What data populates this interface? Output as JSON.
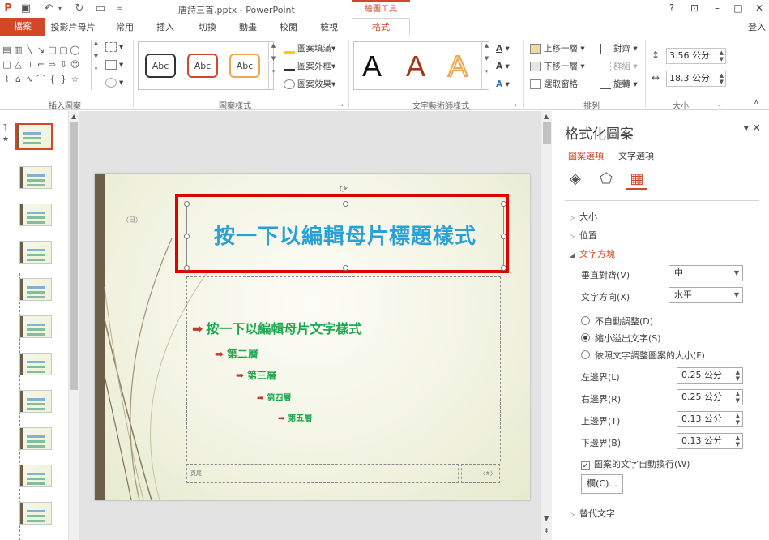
{
  "window": {
    "title": "唐詩三首.pptx - PowerPoint",
    "tools_header": "繪圖工具",
    "help": "?",
    "restore_ribbon": "⊡",
    "minimize": "–",
    "maximize": "□",
    "close": "✕"
  },
  "tabs": [
    {
      "id": "file",
      "label": "檔案"
    },
    {
      "id": "master",
      "label": "投影片母片"
    },
    {
      "id": "home",
      "label": "常用"
    },
    {
      "id": "insert",
      "label": "插入"
    },
    {
      "id": "transitions",
      "label": "切換"
    },
    {
      "id": "animations",
      "label": "動畫"
    },
    {
      "id": "review",
      "label": "校閱"
    },
    {
      "id": "view",
      "label": "檢視"
    },
    {
      "id": "format",
      "label": "格式"
    }
  ],
  "login": "登入",
  "ribbon": {
    "groups": {
      "insert_shapes": "插入圖案",
      "shape_styles": "圖案樣式",
      "wordart_styles": "文字藝術師樣式",
      "arrange": "排列",
      "size": "大小"
    },
    "style_samples": [
      "Abc",
      "Abc",
      "Abc"
    ],
    "shape_fill": "圖案填滿",
    "shape_outline": "圖案外框",
    "shape_effects": "圖案效果",
    "wordart_letters": [
      "A",
      "A",
      "A"
    ],
    "bring_forward": "上移一層",
    "send_backward": "下移一層",
    "selection_pane": "選取窗格",
    "align": "對齊",
    "group": "群組",
    "rotate": "旋轉",
    "height": "3.56 公分",
    "width": "18.3 公分"
  },
  "thumbs": {
    "active_number": "1",
    "active_marker": "★"
  },
  "slide": {
    "date_placeholder": "（日）",
    "title": "按一下以編輯母片標題樣式",
    "bullets": [
      {
        "text": "按一下以編輯母片文字樣式",
        "level": 1
      },
      {
        "text": "第二層",
        "level": 2
      },
      {
        "text": "第三層",
        "level": 3
      },
      {
        "text": "第四層",
        "level": 4
      },
      {
        "text": "第五層",
        "level": 5
      }
    ],
    "footer": "頁尾",
    "slide_number": "〈#〉"
  },
  "pane": {
    "title": "格式化圖案",
    "tab_shape": "圖案選項",
    "tab_text": "文字選項",
    "sections": {
      "size": "大小",
      "position": "位置",
      "textbox": "文字方塊",
      "alt_text": "替代文字"
    },
    "vertical_align_label": "垂直對齊(V)",
    "vertical_align_value": "中",
    "text_direction_label": "文字方向(X)",
    "text_direction_value": "水平",
    "autofit_options": [
      {
        "label": "不自動調整(D)",
        "selected": false
      },
      {
        "label": "縮小溢出文字(S)",
        "selected": true
      },
      {
        "label": "依照文字調整圖案的大小(F)",
        "selected": false
      }
    ],
    "margins": [
      {
        "label": "左邊界(L)",
        "value": "0.25 公分"
      },
      {
        "label": "右邊界(R)",
        "value": "0.25 公分"
      },
      {
        "label": "上邊界(T)",
        "value": "0.13 公分"
      },
      {
        "label": "下邊界(B)",
        "value": "0.13 公分"
      }
    ],
    "wrap_text": "圖案的文字自動換行(W)",
    "wrap_checked": "✓",
    "columns_button": "欄(C)..."
  }
}
